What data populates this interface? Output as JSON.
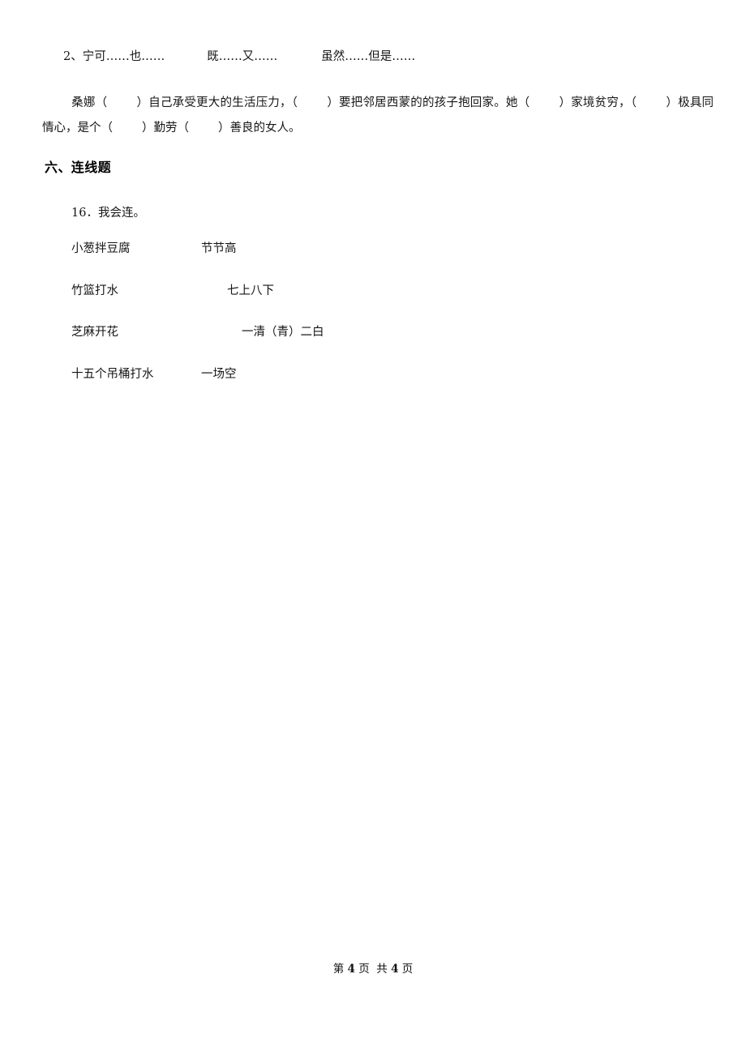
{
  "document": {
    "paper_background": "#ffffff",
    "text_color": "#161616"
  },
  "conjunction_prompt": {
    "number": "2、",
    "option1": "宁可……也……",
    "option2": "既……又……",
    "option3": "虽然……但是……"
  },
  "cloze_paragraph": {
    "seg1": "桑娜（",
    "seg2": "）自己承受更大的生活压力，（",
    "seg3": "）要把邻居西蒙的的孩子抱回家。她（",
    "seg4": "）家境贫穷，（",
    "seg5": "）极具同情心，是个（",
    "seg6": "）勤劳（",
    "seg7": "）善良的女人。"
  },
  "section": {
    "heading": "六、连线题"
  },
  "question": {
    "number": "16",
    "separator": "．",
    "stem": "我会连。"
  },
  "matching": {
    "rows": [
      {
        "left": "小葱拌豆腐",
        "right": "节节高",
        "right_offset": "248px"
      },
      {
        "left": "竹篮打水",
        "right": "七上八下",
        "right_offset": "280px"
      },
      {
        "left": "芝麻开花",
        "right": "一清（青）二白",
        "right_offset": "298px"
      },
      {
        "left": "十五个吊桶打水",
        "right": "一场空",
        "right_offset": "248px"
      }
    ]
  },
  "footer": {
    "prefix": "第",
    "current_page": "4",
    "middle": "页  共",
    "total_pages": "4",
    "suffix": "页"
  }
}
